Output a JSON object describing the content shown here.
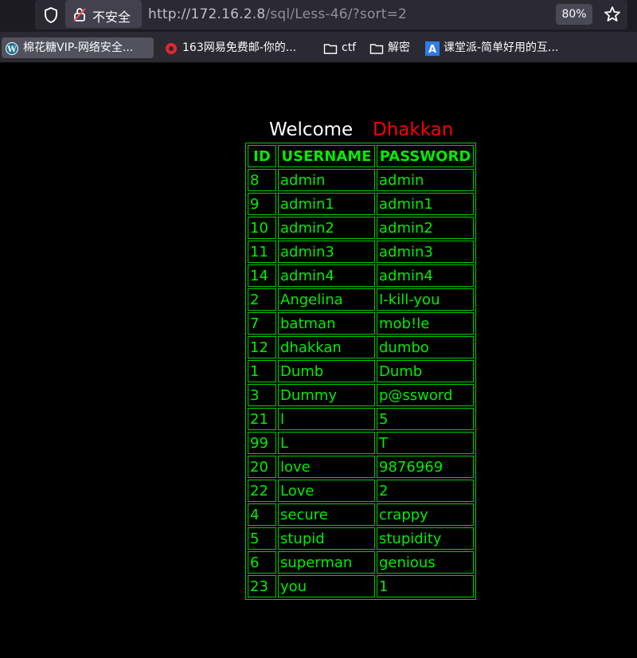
{
  "browser": {
    "insecure_label": "不安全",
    "url_host": "http://172.16.2.8",
    "url_path": "/sql/Less-46/?sort=2",
    "zoom": "80%"
  },
  "bookmarks": [
    {
      "label": "棉花糖VIP-网络安全...",
      "icon": "wordpress-icon"
    },
    {
      "label": "163网易免费邮-你的...",
      "icon": "netease-icon"
    },
    {
      "label": "ctf",
      "icon": "folder-icon"
    },
    {
      "label": "解密",
      "icon": "folder-icon"
    },
    {
      "label": "课堂派-简单好用的互...",
      "icon": "ketangpai-icon"
    }
  ],
  "page": {
    "welcome": "Welcome",
    "name": "Dhakkan",
    "columns": [
      "ID",
      "USERNAME",
      "PASSWORD"
    ],
    "rows": [
      [
        "8",
        "admin",
        "admin"
      ],
      [
        "9",
        "admin1",
        "admin1"
      ],
      [
        "10",
        "admin2",
        "admin2"
      ],
      [
        "11",
        "admin3",
        "admin3"
      ],
      [
        "14",
        "admin4",
        "admin4"
      ],
      [
        "2",
        "Angelina",
        "I-kill-you"
      ],
      [
        "7",
        "batman",
        "mob!le"
      ],
      [
        "12",
        "dhakkan",
        "dumbo"
      ],
      [
        "1",
        "Dumb",
        "Dumb"
      ],
      [
        "3",
        "Dummy",
        "p@ssword"
      ],
      [
        "21",
        "l",
        "5"
      ],
      [
        "99",
        "L",
        "T"
      ],
      [
        "20",
        "love",
        "9876969"
      ],
      [
        "22",
        "Love",
        "2"
      ],
      [
        "4",
        "secure",
        "crappy"
      ],
      [
        "5",
        "stupid",
        "stupidity"
      ],
      [
        "6",
        "superman",
        "genious"
      ],
      [
        "23",
        "you",
        "1"
      ]
    ]
  },
  "colors": {
    "table_text": "#00ee00",
    "table_border": "#00cc00",
    "name": "#ff0000",
    "background": "#000000"
  }
}
